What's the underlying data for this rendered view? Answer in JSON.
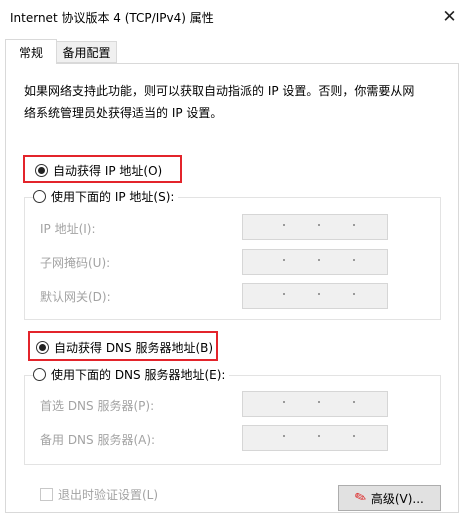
{
  "window": {
    "title": "Internet 协议版本 4 (TCP/IPv4) 属性",
    "close_glyph": "✕"
  },
  "tabs": [
    {
      "label": "常规",
      "active": true
    },
    {
      "label": "备用配置",
      "active": false
    }
  ],
  "description": "如果网络支持此功能，则可以获取自动指派的 IP 设置。否则，你需要从网\n络系统管理员处获得适当的 IP 设置。",
  "ip_section": {
    "auto_label": "自动获得 IP 地址(O)",
    "auto_selected": true,
    "manual_label": "使用下面的 IP 地址(S):",
    "manual_selected": false,
    "fields": [
      {
        "label": "IP 地址(I):",
        "value": ".   .   ."
      },
      {
        "label": "子网掩码(U):",
        "value": ".   .   ."
      },
      {
        "label": "默认网关(D):",
        "value": ".   .   ."
      }
    ]
  },
  "dns_section": {
    "auto_label": "自动获得 DNS 服务器地址(B)",
    "auto_selected": true,
    "manual_label": "使用下面的 DNS 服务器地址(E):",
    "manual_selected": false,
    "fields": [
      {
        "label": "首选 DNS 服务器(P):",
        "value": ".   .   ."
      },
      {
        "label": "备用 DNS 服务器(A):",
        "value": ".   .   ."
      }
    ]
  },
  "validate_checkbox": {
    "label": "退出时验证设置(L)",
    "checked": false
  },
  "advanced_button": {
    "label": "高级(V)..."
  },
  "colors": {
    "highlight": "#e3242b",
    "disabled_text": "#a3a3a3",
    "field_bg": "#f0f0f0"
  }
}
